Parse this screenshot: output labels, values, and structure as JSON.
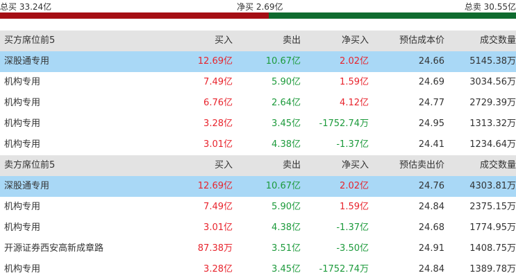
{
  "summary": {
    "buy_total": "总买 33.24亿",
    "net_buy": "净买 2.69亿",
    "sell_total": "总卖 30.55亿",
    "buy_fraction": 0.5211,
    "buy_color": "#a50e14",
    "sell_color": "#0f6b2f"
  },
  "buy_section": {
    "headers": [
      "买方席位前5",
      "买入",
      "卖出",
      "净买入",
      "预估成本价",
      "成交数量"
    ],
    "rows": [
      {
        "name": "深股通专用",
        "buy": "12.69亿",
        "sell": "10.67亿",
        "net": "2.02亿",
        "price": "24.66",
        "volume": "5145.38万"
      },
      {
        "name": "机构专用",
        "buy": "7.49亿",
        "sell": "5.90亿",
        "net": "1.59亿",
        "price": "24.69",
        "volume": "3034.56万"
      },
      {
        "name": "机构专用",
        "buy": "6.76亿",
        "sell": "2.64亿",
        "net": "4.12亿",
        "price": "24.77",
        "volume": "2729.39万"
      },
      {
        "name": "机构专用",
        "buy": "3.28亿",
        "sell": "3.45亿",
        "net": "-1752.74万",
        "price": "24.95",
        "volume": "1313.32万"
      },
      {
        "name": "机构专用",
        "buy": "3.01亿",
        "sell": "4.38亿",
        "net": "-1.37亿",
        "price": "24.41",
        "volume": "1234.64万"
      }
    ]
  },
  "sell_section": {
    "headers": [
      "卖方席位前5",
      "买入",
      "卖出",
      "净买入",
      "预估卖出价",
      "成交数量"
    ],
    "rows": [
      {
        "name": "深股通专用",
        "buy": "12.69亿",
        "sell": "10.67亿",
        "net": "2.02亿",
        "price": "24.76",
        "volume": "4303.81万"
      },
      {
        "name": "机构专用",
        "buy": "7.49亿",
        "sell": "5.90亿",
        "net": "1.59亿",
        "price": "24.84",
        "volume": "2375.15万"
      },
      {
        "name": "机构专用",
        "buy": "3.01亿",
        "sell": "4.38亿",
        "net": "-1.37亿",
        "price": "24.68",
        "volume": "1774.95万"
      },
      {
        "name": "开源证券西安高新成章路",
        "buy": "87.38万",
        "sell": "3.51亿",
        "net": "-3.50亿",
        "price": "24.91",
        "volume": "1408.75万"
      },
      {
        "name": "机构专用",
        "buy": "3.28亿",
        "sell": "3.45亿",
        "net": "-1752.74万",
        "price": "24.84",
        "volume": "1389.78万"
      }
    ]
  },
  "colors": {
    "buy_text": "#e8242d",
    "sell_text": "#1c9a3b",
    "net_positive": "#e8242d",
    "net_negative": "#333333",
    "highlight_row": "#a9d8f6",
    "header_row": "#e3e3e3"
  }
}
